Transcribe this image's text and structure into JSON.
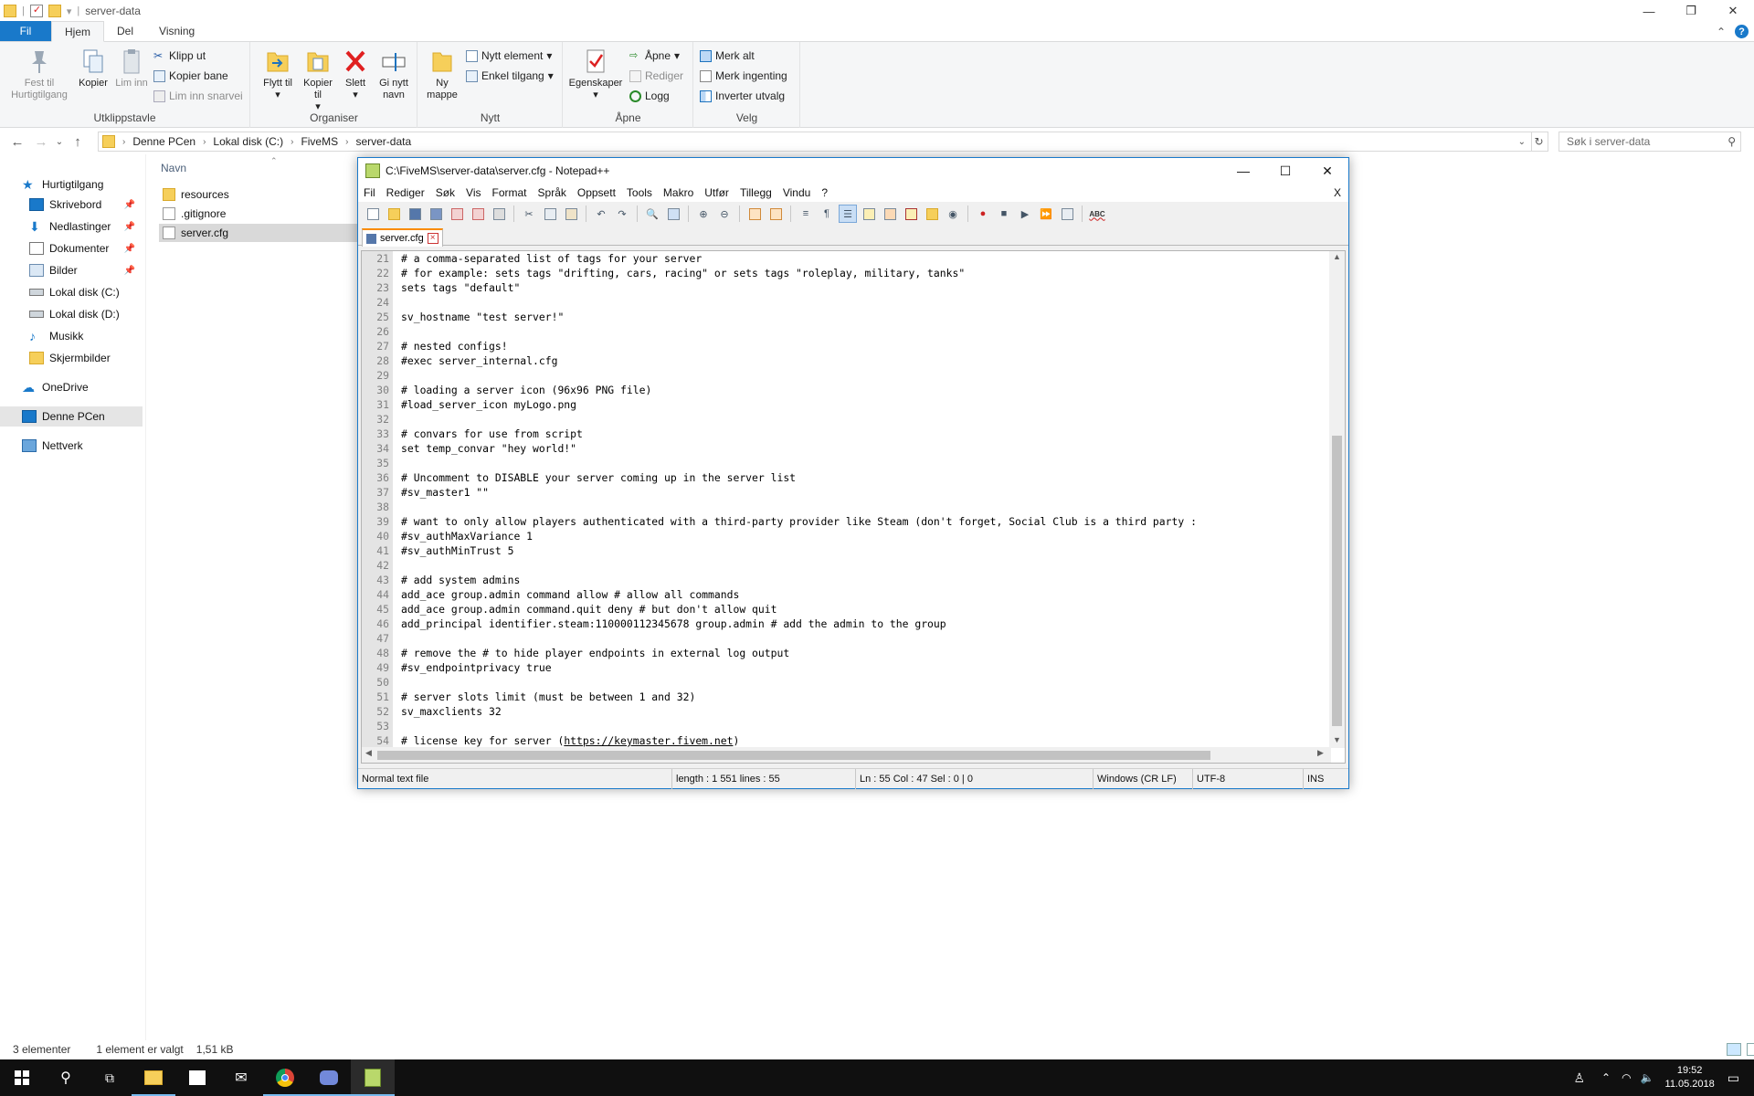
{
  "explorer": {
    "title": "server-data",
    "ribbon_tabs": [
      "Fil",
      "Hjem",
      "Del",
      "Visning"
    ],
    "ribbon": {
      "clipboard": {
        "label": "Utklippstavle",
        "pin": "Fest til Hurtigtilgang",
        "copy": "Kopier",
        "paste": "Lim inn",
        "cut": "Klipp ut",
        "copy_path": "Kopier bane",
        "paste_shortcut": "Lim inn snarvei"
      },
      "organize": {
        "label": "Organiser",
        "move_to": "Flytt til",
        "copy_to": "Kopier til",
        "delete": "Slett",
        "rename": "Gi nytt navn"
      },
      "new": {
        "label": "Nytt",
        "new_folder": "Ny mappe",
        "new_item": "Nytt element",
        "easy_access": "Enkel tilgang"
      },
      "open": {
        "label": "Åpne",
        "properties": "Egenskaper",
        "open": "Åpne",
        "edit": "Rediger",
        "history": "Logg"
      },
      "select": {
        "label": "Velg",
        "select_all": "Merk alt",
        "select_none": "Merk ingenting",
        "invert": "Inverter utvalg"
      }
    },
    "address": [
      "Denne PCen",
      "Lokal disk (C:)",
      "FiveMS",
      "server-data"
    ],
    "search_placeholder": "Søk i server-data",
    "nav": [
      {
        "label": "Hurtigtilgang",
        "icon": "star-icon"
      },
      {
        "label": "Skrivebord",
        "icon": "desktop-icon",
        "pinned": true
      },
      {
        "label": "Nedlastinger",
        "icon": "download-icon",
        "pinned": true
      },
      {
        "label": "Dokumenter",
        "icon": "documents-icon",
        "pinned": true
      },
      {
        "label": "Bilder",
        "icon": "pictures-icon",
        "pinned": true
      },
      {
        "label": "Lokal disk (C:)",
        "icon": "drive-icon"
      },
      {
        "label": "Lokal disk (D:)",
        "icon": "drive-icon"
      },
      {
        "label": "Musikk",
        "icon": "music-icon"
      },
      {
        "label": "Skjermbilder",
        "icon": "folder-icon"
      },
      {
        "label": "OneDrive",
        "icon": "cloud-icon"
      },
      {
        "label": "Denne PCen",
        "icon": "computer-icon"
      },
      {
        "label": "Nettverk",
        "icon": "network-icon"
      }
    ],
    "column_name": "Navn",
    "files": [
      "resources",
      ".gitignore",
      "server.cfg"
    ],
    "status": {
      "count": "3 elementer",
      "selection": "1 element er valgt",
      "size": "1,51 kB"
    }
  },
  "npp": {
    "title": "C:\\FiveMS\\server-data\\server.cfg - Notepad++",
    "menu": [
      "Fil",
      "Rediger",
      "Søk",
      "Vis",
      "Format",
      "Språk",
      "Oppsett",
      "Tools",
      "Makro",
      "Utfør",
      "Tillegg",
      "Vindu",
      "?"
    ],
    "menu_close": "X",
    "tab_name": "server.cfg",
    "line_numbers": [
      "21",
      "22",
      "23",
      "24",
      "25",
      "26",
      "27",
      "28",
      "29",
      "30",
      "31",
      "32",
      "33",
      "34",
      "35",
      "36",
      "37",
      "38",
      "39",
      "40",
      "41",
      "42",
      "43",
      "44",
      "45",
      "46",
      "47",
      "48",
      "49",
      "50",
      "51",
      "52",
      "53",
      "54"
    ],
    "lines": [
      "# a comma-separated list of tags for your server",
      "# for example: sets tags \"drifting, cars, racing\" or sets tags \"roleplay, military, tanks\"",
      "sets tags \"default\"",
      "",
      "sv_hostname \"test server!\"",
      "",
      "# nested configs!",
      "#exec server_internal.cfg",
      "",
      "# loading a server icon (96x96 PNG file)",
      "#load_server_icon myLogo.png",
      "",
      "# convars for use from script",
      "set temp_convar \"hey world!\"",
      "",
      "# Uncomment to DISABLE your server coming up in the server list",
      "#sv_master1 \"\"",
      "",
      "# want to only allow players authenticated with a third-party provider like Steam (don't forget, Social Club is a third party :",
      "#sv_authMaxVariance 1",
      "#sv_authMinTrust 5",
      "",
      "# add system admins",
      "add_ace group.admin command allow # allow all commands",
      "add_ace group.admin command.quit deny # but don't allow quit",
      "add_principal identifier.steam:110000112345678 group.admin # add the admin to the group",
      "",
      "# remove the # to hide player endpoints in external log output",
      "#sv_endpointprivacy true",
      "",
      "# server slots limit (must be between 1 and 32)",
      "sv_maxclients 32",
      "",
      "# license key for server ("
    ],
    "license_link": "https://keymaster.fivem.net",
    "license_suffix": ")",
    "status": {
      "type": "Normal text file",
      "length": "length : 1 551    lines : 55",
      "pos": "Ln : 55    Col : 47    Sel : 0 | 0",
      "eol": "Windows (CR LF)",
      "encoding": "UTF-8",
      "mode": "INS"
    }
  },
  "taskbar": {
    "time": "19:52",
    "date": "11.05.2018"
  }
}
